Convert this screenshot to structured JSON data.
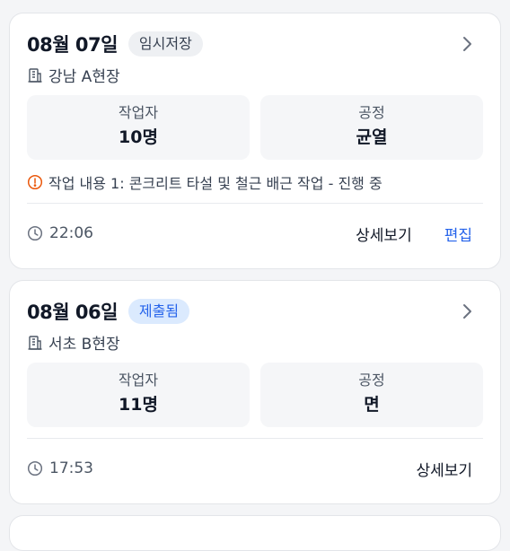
{
  "reports": [
    {
      "date": "08월 07일",
      "status": "임시저장",
      "site": "강남 A현장",
      "workers_label": "작업자",
      "workers_value": "10명",
      "process_label": "공정",
      "process_value": "균열",
      "note": "작업 내용 1: 콘크리트 타설 및 철근 배근 작업 - 진행 중",
      "time": "22:06",
      "detail_label": "상세보기",
      "edit_label": "편집"
    },
    {
      "date": "08월 06일",
      "status": "제출됨",
      "site": "서초 B현장",
      "workers_label": "작업자",
      "workers_value": "11명",
      "process_label": "공정",
      "process_value": "면",
      "time": "17:53",
      "detail_label": "상세보기"
    }
  ],
  "icons": {
    "site": "building-icon",
    "note": "alert-circle-icon",
    "time": "clock-icon",
    "open": "chevron-right-icon"
  },
  "colors": {
    "accent": "#2563eb",
    "warning": "#ea580c",
    "draft_badge_bg": "#eef0f3",
    "submitted_badge_bg": "#dbeafe"
  }
}
